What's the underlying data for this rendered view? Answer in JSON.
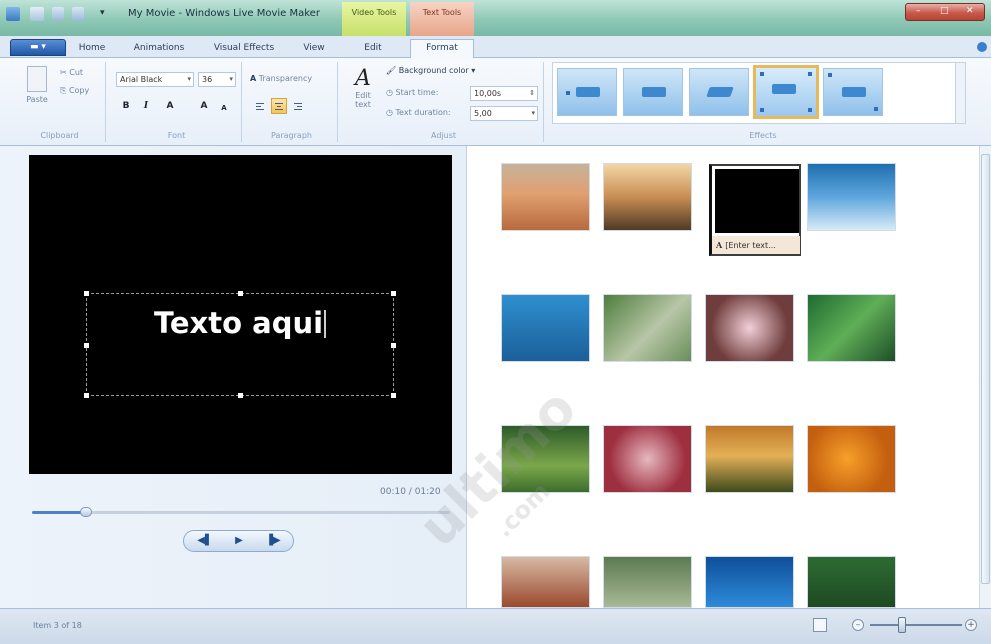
{
  "titlebar": {
    "title": "My Movie - Windows Live Movie Maker",
    "video_tools": "Video Tools",
    "text_tools": "Text Tools"
  },
  "tabs": [
    {
      "label": "Home"
    },
    {
      "label": "Animations"
    },
    {
      "label": "Visual Effects"
    },
    {
      "label": "View"
    },
    {
      "label": "Edit"
    },
    {
      "label": "Format"
    }
  ],
  "ribbon": {
    "clipboard": {
      "paste": "Paste",
      "cut": "Cut",
      "copy": "Copy",
      "label": "Clipboard"
    },
    "font": {
      "family": "Arial Black",
      "size": "36",
      "bold": "B",
      "italic": "I",
      "color": "A",
      "grow": "A",
      "shrink": "A",
      "label": "Font"
    },
    "paragraph": {
      "transparency": "Transparency",
      "label": "Paragraph"
    },
    "adjust": {
      "edit_text": "Edit text",
      "background_color": "Background color",
      "start_time_label": "Start time:",
      "start_time_value": "10,00s",
      "text_duration_label": "Text duration:",
      "text_duration_value": "5,00",
      "label": "Adjust"
    },
    "effects": {
      "label": "Effects"
    }
  },
  "preview": {
    "text": "Texto aqui",
    "timecode": "00:10 / 01:20",
    "seek_fraction": 0.13
  },
  "storyboard": {
    "text_item_caption": "[Enter text..."
  },
  "status": {
    "item_text": "Item 3 of 18",
    "zoom_fraction": 0.35
  },
  "watermark": {
    "main": "ultimo",
    "sub": ".com"
  },
  "colors": {
    "accent": "#1f57a8",
    "video_tools": "#c6e06a",
    "text_tools": "#e7a68a",
    "selection": "#e8b85a"
  }
}
